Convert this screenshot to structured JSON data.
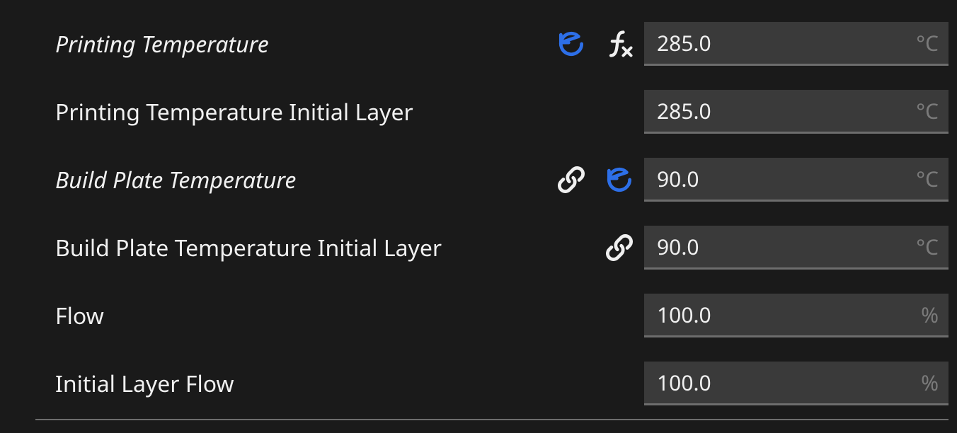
{
  "settings": [
    {
      "id": "printing_temperature",
      "label": "Printing Temperature",
      "italic": true,
      "value": "285.0",
      "unit": "°C",
      "icons": [
        "reset",
        "fx"
      ]
    },
    {
      "id": "printing_temperature_initial_layer",
      "label": "Printing Temperature Initial Layer",
      "italic": false,
      "value": "285.0",
      "unit": "°C",
      "icons": []
    },
    {
      "id": "build_plate_temperature",
      "label": "Build Plate Temperature",
      "italic": true,
      "value": "90.0",
      "unit": "°C",
      "icons": [
        "link",
        "reset"
      ]
    },
    {
      "id": "build_plate_temperature_initial_layer",
      "label": "Build Plate Temperature Initial Layer",
      "italic": false,
      "value": "90.0",
      "unit": "°C",
      "icons": [
        "link"
      ]
    },
    {
      "id": "flow",
      "label": "Flow",
      "italic": false,
      "value": "100.0",
      "unit": "%",
      "icons": []
    },
    {
      "id": "initial_layer_flow",
      "label": "Initial Layer Flow",
      "italic": false,
      "value": "100.0",
      "unit": "%",
      "icons": []
    }
  ],
  "colors": {
    "accent": "#2d6fe8",
    "text": "#f0f0f0",
    "muted": "#7a7a7a"
  }
}
